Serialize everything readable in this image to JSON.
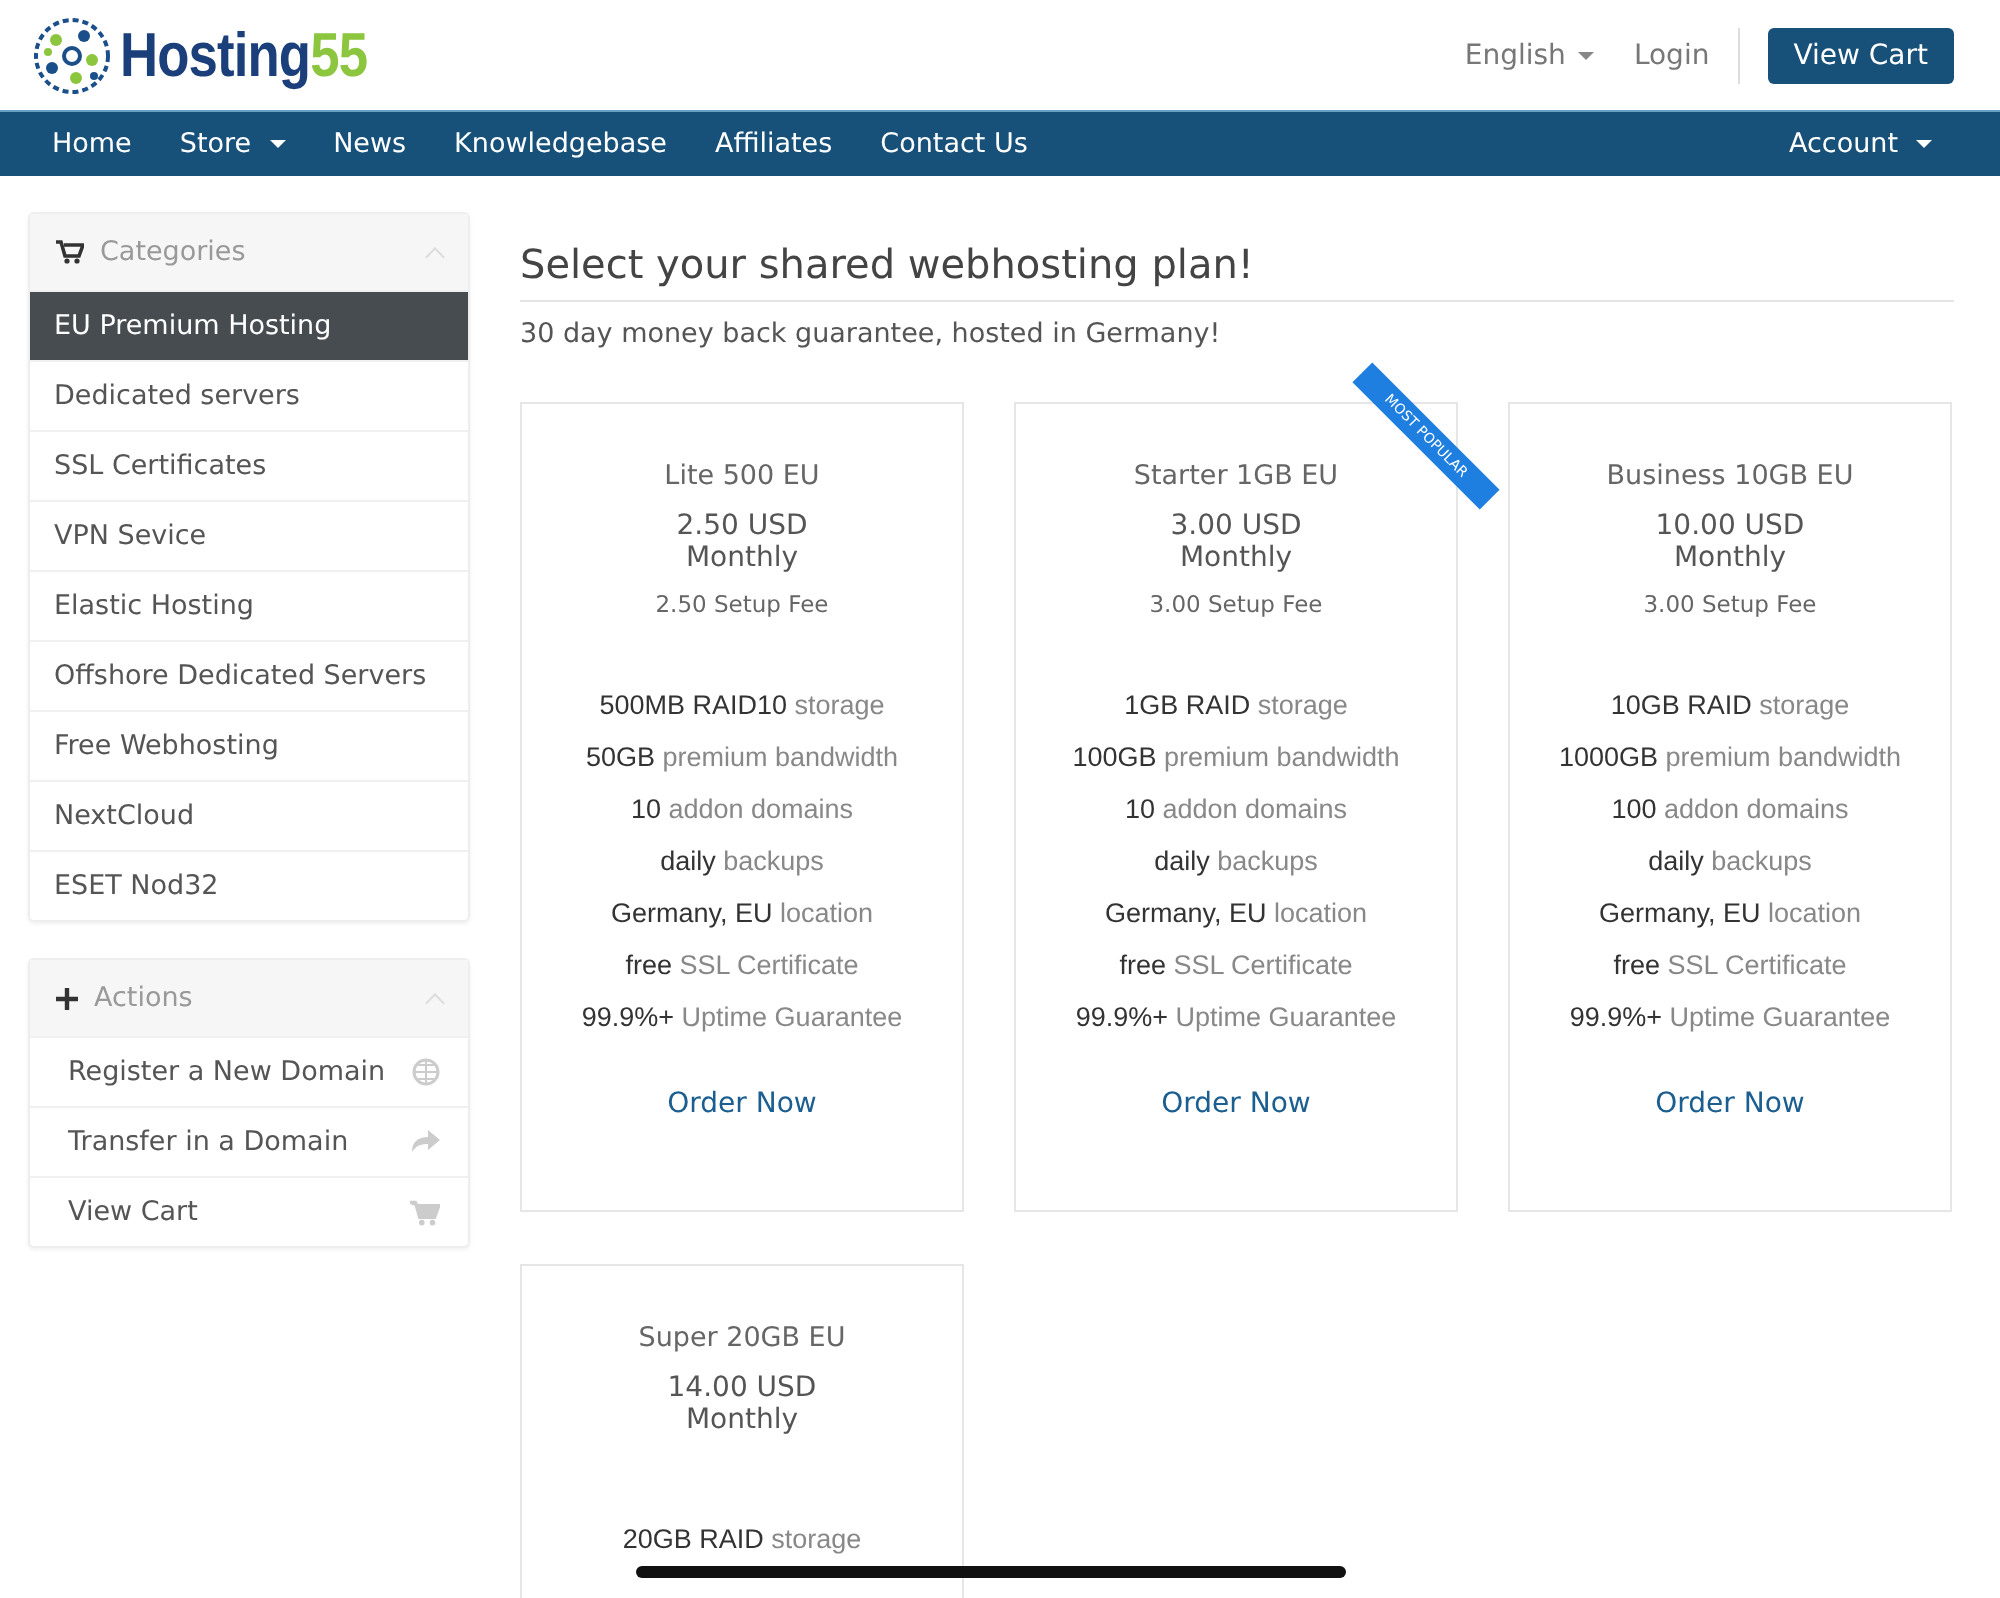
{
  "header": {
    "logo_text": "Hosting",
    "logo_number": "55",
    "language": "English",
    "login": "Login",
    "cart_button": "View Cart"
  },
  "nav": {
    "items": [
      {
        "label": "Home",
        "dropdown": false
      },
      {
        "label": "Store",
        "dropdown": true
      },
      {
        "label": "News",
        "dropdown": false
      },
      {
        "label": "Knowledgebase",
        "dropdown": false
      },
      {
        "label": "Affiliates",
        "dropdown": false
      },
      {
        "label": "Contact Us",
        "dropdown": false
      }
    ],
    "account": "Account"
  },
  "sidebar": {
    "categories": {
      "title": "Categories",
      "items": [
        {
          "label": "EU Premium Hosting",
          "selected": true
        },
        {
          "label": "Dedicated servers",
          "selected": false
        },
        {
          "label": "SSL Certificates",
          "selected": false
        },
        {
          "label": "VPN Sevice",
          "selected": false
        },
        {
          "label": "Elastic Hosting",
          "selected": false
        },
        {
          "label": "Offshore Dedicated Servers",
          "selected": false
        },
        {
          "label": "Free Webhosting",
          "selected": false
        },
        {
          "label": "NextCloud",
          "selected": false
        },
        {
          "label": "ESET Nod32",
          "selected": false
        }
      ]
    },
    "actions": {
      "title": "Actions",
      "items": [
        {
          "label": "Register a New Domain",
          "kind": "globe"
        },
        {
          "label": "Transfer in a Domain",
          "kind": "share"
        },
        {
          "label": "View Cart",
          "kind": "cart"
        }
      ]
    }
  },
  "main": {
    "title": "Select your shared webhosting plan!",
    "subtitle": "30 day money back guarantee, hosted in Germany!",
    "plans": [
      {
        "name": "Lite 500 EU",
        "price": "2.50 USD",
        "cycle": "Monthly",
        "setup_fee": "2.50 Setup Fee",
        "features": [
          "**500MB RAID10** storage",
          "**50GB** premium bandwidth",
          "**10** addon domains",
          "**daily** backups",
          "**Germany, EU** location",
          "**free** SSL Certificate",
          "**99.9%+** Uptime Guarantee"
        ],
        "order": "Order Now"
      },
      {
        "name": "Starter 1GB EU",
        "price": "3.00 USD",
        "cycle": "Monthly",
        "setup_fee": "3.00 Setup Fee",
        "ribbon": "MOST POPULAR",
        "features": [
          "**1GB RAID** storage",
          "**100GB** premium bandwidth",
          "**10** addon domains",
          "**daily** backups",
          "**Germany, EU** location",
          "**free** SSL Certificate",
          "**99.9%+** Uptime Guarantee"
        ],
        "order": "Order Now"
      },
      {
        "name": "Business 10GB EU",
        "price": "10.00 USD",
        "cycle": "Monthly",
        "setup_fee": "3.00 Setup Fee",
        "features": [
          "**10GB RAID** storage",
          "**1000GB** premium bandwidth",
          "**100** addon domains",
          "**daily** backups",
          "**Germany, EU** location",
          "**free** SSL Certificate",
          "**99.9%+** Uptime Guarantee"
        ],
        "order": "Order Now"
      },
      {
        "name": "Super 20GB EU",
        "price": "14.00 USD",
        "cycle": "Monthly",
        "features": [
          "**20GB RAID** storage"
        ]
      }
    ]
  }
}
